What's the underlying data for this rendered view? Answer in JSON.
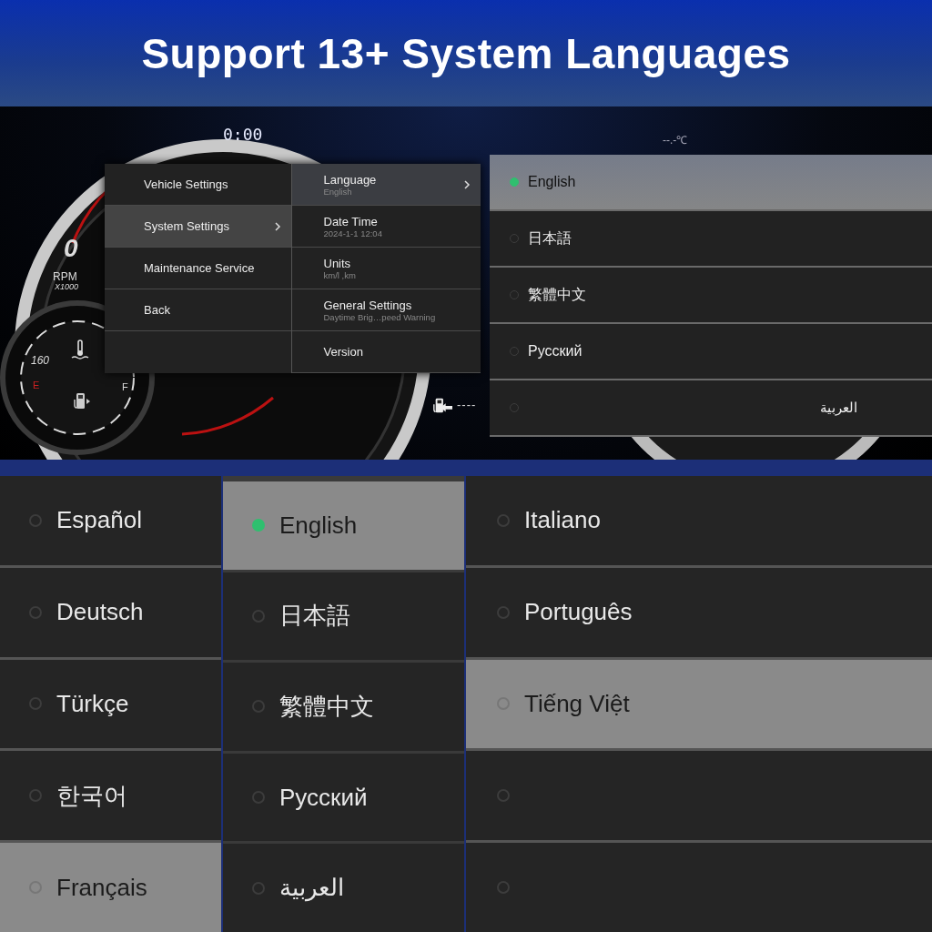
{
  "headline": "Support 13+ System Languages",
  "dashboard": {
    "clock": "0:00",
    "temperature": "--.-℃",
    "rpm_value": "0",
    "rpm_label": "RPM",
    "rpm_scale": "X1000",
    "temp_scale": "160",
    "fuel_empty": "E",
    "fuel_full": "F",
    "fuel_range": "----"
  },
  "menu": {
    "main_items": [
      {
        "label": "Vehicle Settings",
        "selected": false,
        "has_submenu": false
      },
      {
        "label": "System Settings",
        "selected": true,
        "has_submenu": true
      },
      {
        "label": "Maintenance Service",
        "selected": false,
        "has_submenu": false
      },
      {
        "label": "Back",
        "selected": false,
        "has_submenu": false
      }
    ],
    "sub_items": [
      {
        "label": "Language",
        "value": "English",
        "selected": true,
        "has_submenu": true
      },
      {
        "label": "Date Time",
        "value": "2024-1-1 12:04",
        "selected": false,
        "has_submenu": false
      },
      {
        "label": "Units",
        "value": "km/l ,km",
        "selected": false,
        "has_submenu": false
      },
      {
        "label": "General Settings",
        "value": "Daytime Brig…peed Warning",
        "selected": false,
        "has_submenu": false
      },
      {
        "label": "Version",
        "selected": false,
        "has_submenu": false
      }
    ]
  },
  "language_popup": [
    {
      "label": "English",
      "selected": true,
      "highlighted": true,
      "kind": "start"
    },
    {
      "label": "日本語",
      "selected": false,
      "highlighted": false,
      "kind": "start"
    },
    {
      "label": "繁體中文",
      "selected": false,
      "highlighted": false,
      "kind": "start"
    },
    {
      "label": "Русский",
      "selected": false,
      "highlighted": false,
      "kind": "start"
    },
    {
      "label": "العربية",
      "selected": false,
      "highlighted": false,
      "kind": "end"
    }
  ],
  "language_columns": [
    [
      {
        "label": "Español",
        "selected": false,
        "highlighted": false
      },
      {
        "label": "Deutsch",
        "selected": false,
        "highlighted": false
      },
      {
        "label": "Türkçe",
        "selected": false,
        "highlighted": false
      },
      {
        "label": "한국어",
        "selected": false,
        "highlighted": false
      },
      {
        "label": "Français",
        "selected": false,
        "highlighted": true
      }
    ],
    [
      {
        "label": "English",
        "selected": true,
        "highlighted": true
      },
      {
        "label": "日本語",
        "selected": false,
        "highlighted": false
      },
      {
        "label": "繁體中文",
        "selected": false,
        "highlighted": false
      },
      {
        "label": "Русский",
        "selected": false,
        "highlighted": false
      },
      {
        "label": "العربية",
        "selected": false,
        "highlighted": false
      }
    ],
    [
      {
        "label": "Italiano",
        "selected": false,
        "highlighted": false
      },
      {
        "label": "Português",
        "selected": false,
        "highlighted": false
      },
      {
        "label": "Tiếng Việt",
        "selected": false,
        "highlighted": true
      },
      {
        "selected": false,
        "highlighted": false
      },
      {
        "selected": false,
        "highlighted": false
      }
    ]
  ]
}
